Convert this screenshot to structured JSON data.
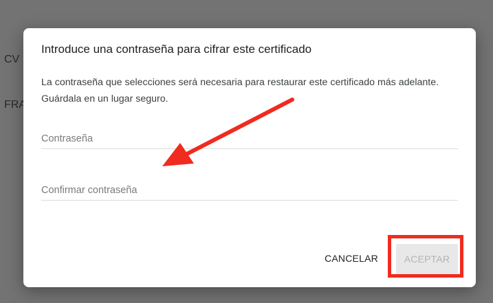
{
  "background": {
    "partial_text_1": "CV",
    "partial_text_2": "FRA"
  },
  "dialog": {
    "title": "Introduce una contraseña para cifrar este certificado",
    "body": "La contraseña que selecciones será necesaria para restaurar este certificado más adelante. Guárdala en un lugar seguro.",
    "password_placeholder": "Contraseña",
    "confirm_placeholder": "Confirmar contraseña",
    "cancel_label": "CANCELAR",
    "accept_label": "ACEPTAR",
    "accept_disabled": true
  },
  "annotations": {
    "highlight_color": "#f02b1f",
    "arrow_color": "#f02b1f",
    "arrow_icon": "red-arrow-icon",
    "highlight_target": "accept-button"
  }
}
